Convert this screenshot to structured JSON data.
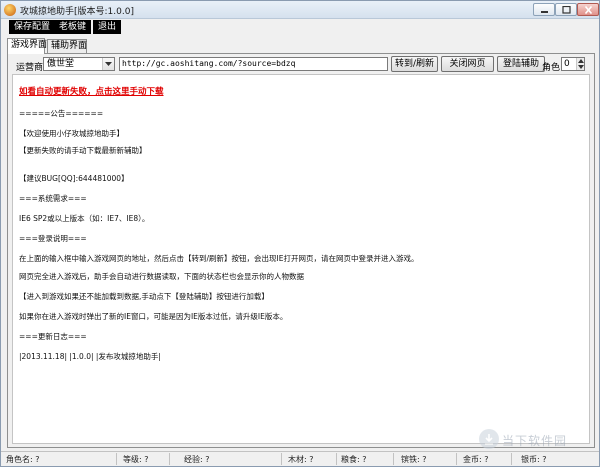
{
  "window": {
    "title": "攻城掠地助手[版本号:1.0.0]"
  },
  "menu": {
    "items": [
      "保存配置",
      "老板键",
      "退出"
    ]
  },
  "tabs": [
    "游戏界面",
    "辅助界面"
  ],
  "toolbar": {
    "operator_label": "运营商",
    "operator_value": "傲世堂",
    "url": "http://gc.aoshitang.com/?source=bdzq",
    "goto_button": "转到/刷新",
    "close_page_button": "关闭网页",
    "login_button": "登陆辅助",
    "role_label": "角色",
    "role_value": "0"
  },
  "document": {
    "link": "如看自动更新失败，点击这里手动下载",
    "lines": [
      "=====公告======",
      "【欢迎使用小仔攻城掠地助手】",
      "【更新失败的请手动下载最新新辅助】",
      "【建议BUG[QQ]:644481000】",
      "===系统需求===",
      "IE6 SP2或以上版本（如：IE7、IE8）。",
      "===登录说明===",
      "在上面的输入框中输入游戏网页的地址，然后点击【转到/刷新】按钮，会出现IE打开网页，请在网页中登录并进入游戏。",
      "网页完全进入游戏后，助手会自动进行数据读取，下面的状态栏也会显示你的人物数据",
      "【进入到游戏如果还不能加载到数据,手动点下【登陆辅助】按钮进行加载】",
      "如果你在进入游戏时弹出了新的IE窗口，可能是因为IE版本过低，请升级IE版本。",
      "===更新日志===",
      "|2013.11.18|    |1.0.0|    |发布攻城掠地助手|"
    ]
  },
  "status": {
    "role_name": "角色名: ?",
    "level": "等级: ?",
    "exp": "经验: ?",
    "wood": "木材: ?",
    "food": "粮食: ?",
    "iron": "镔铁: ?",
    "gold": "金币: ?",
    "silver": "银币: ?"
  },
  "watermark": "当下软件园"
}
